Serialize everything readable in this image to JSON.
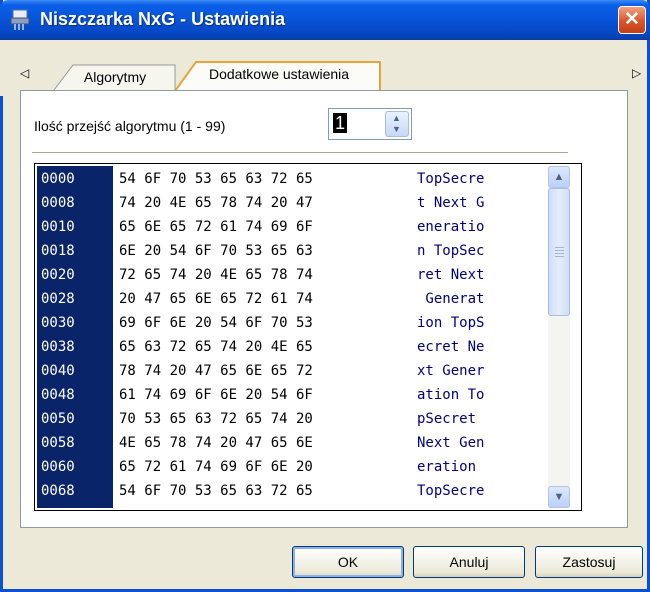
{
  "window": {
    "title": "Niszczarka NxG - Ustawienia",
    "close_label": "✕"
  },
  "tabs": [
    {
      "label": "Algorytmy",
      "active": false
    },
    {
      "label": "Dodatkowe ustawienia",
      "active": true
    }
  ],
  "tab_scroll": {
    "left": "◁",
    "right": "▷"
  },
  "settings": {
    "passes_label": "Ilość przejść algorytmu (1 - 99)",
    "passes_value": "1",
    "spin_up": "▲",
    "spin_down": "▼"
  },
  "hex_view": {
    "rows": [
      {
        "address": "0000",
        "hex": "54 6F 70 53 65 63 72 65",
        "ascii": "TopSecre"
      },
      {
        "address": "0008",
        "hex": "74 20 4E 65 78 74 20 47",
        "ascii": "t Next G"
      },
      {
        "address": "0010",
        "hex": "65 6E 65 72 61 74 69 6F",
        "ascii": "eneratio"
      },
      {
        "address": "0018",
        "hex": "6E 20 54 6F 70 53 65 63",
        "ascii": "n TopSec"
      },
      {
        "address": "0020",
        "hex": "72 65 74 20 4E 65 78 74",
        "ascii": "ret Next"
      },
      {
        "address": "0028",
        "hex": "20 47 65 6E 65 72 61 74",
        "ascii": " Generat"
      },
      {
        "address": "0030",
        "hex": "69 6F 6E 20 54 6F 70 53",
        "ascii": "ion TopS"
      },
      {
        "address": "0038",
        "hex": "65 63 72 65 74 20 4E 65",
        "ascii": "ecret Ne"
      },
      {
        "address": "0040",
        "hex": "78 74 20 47 65 6E 65 72",
        "ascii": "xt Gener"
      },
      {
        "address": "0048",
        "hex": "61 74 69 6F 6E 20 54 6F",
        "ascii": "ation To"
      },
      {
        "address": "0050",
        "hex": "70 53 65 63 72 65 74 20",
        "ascii": "pSecret "
      },
      {
        "address": "0058",
        "hex": "4E 65 78 74 20 47 65 6E",
        "ascii": "Next Gen"
      },
      {
        "address": "0060",
        "hex": "65 72 61 74 69 6F 6E 20",
        "ascii": "eration "
      },
      {
        "address": "0068",
        "hex": "54 6F 70 53 65 63 72 65",
        "ascii": "TopSecre"
      }
    ],
    "scroll_up": "▲",
    "scroll_down": "▼"
  },
  "buttons": {
    "ok": "OK",
    "cancel": "Anuluj",
    "apply": "Zastosuj"
  },
  "colors": {
    "address_bg": "#0a246a",
    "ascii_text": "#000080",
    "titlebar": "#0754d8"
  }
}
